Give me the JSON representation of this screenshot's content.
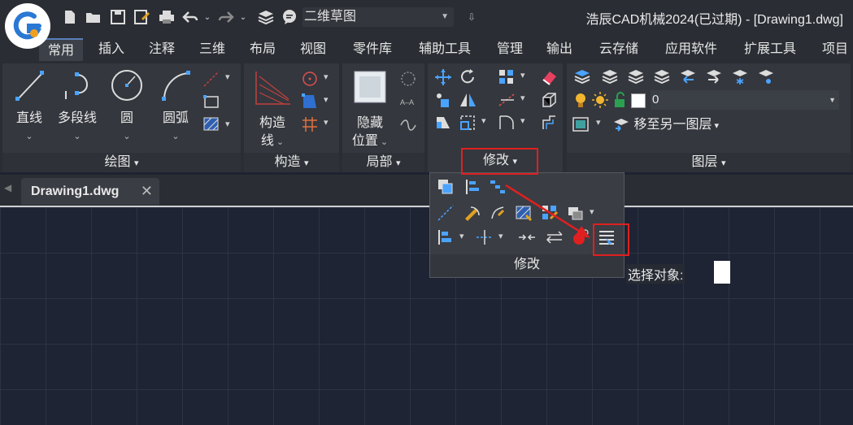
{
  "app": {
    "title": "浩辰CAD机械2024(已过期) - [Drawing1.dwg]",
    "workspace": "二维草图"
  },
  "menu_tabs": [
    "常用",
    "插入",
    "注释",
    "三维",
    "布局",
    "视图",
    "零件库",
    "辅助工具",
    "管理",
    "输出",
    "云存储",
    "应用软件",
    "扩展工具",
    "项目"
  ],
  "panels": {
    "draw": {
      "title": "绘图",
      "tools": [
        "直线",
        "多段线",
        "圆",
        "圆弧"
      ]
    },
    "construct": {
      "title": "构造",
      "tools": [
        "构造",
        "线"
      ]
    },
    "local": {
      "title": "局部",
      "tools": [
        "隐藏",
        "位置"
      ]
    },
    "modify": {
      "title": "修改"
    },
    "layers": {
      "title": "图层",
      "current_layer": "0",
      "move_to_layer": "移至另一图层"
    }
  },
  "document": {
    "tab": "Drawing1.dwg",
    "close": "✕"
  },
  "dropdown": {
    "title": "修改"
  },
  "command": {
    "prompt": "选择对象:"
  },
  "colors": {
    "accent": "#5a7fb8",
    "highlight": "#e02020",
    "bulb": "#f2b530"
  }
}
